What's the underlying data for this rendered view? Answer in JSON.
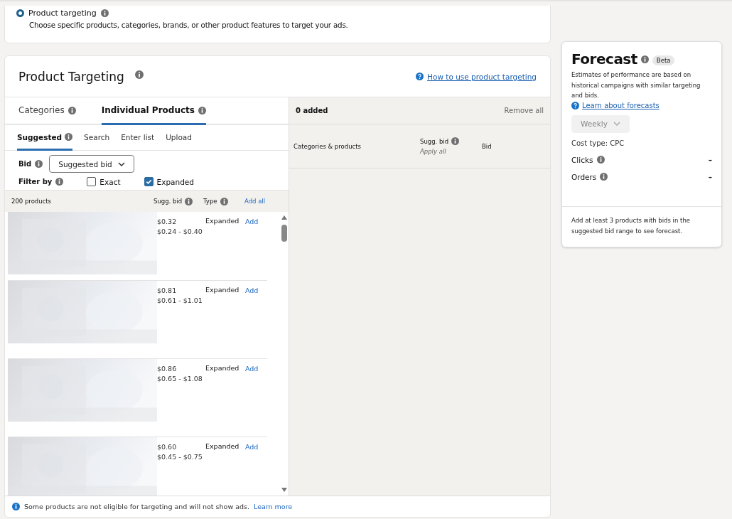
{
  "targeting_option": {
    "label": "Product targeting",
    "selected": true,
    "description": "Choose specific products, categories, brands, or other product features to target your ads."
  },
  "product_targeting": {
    "title": "Product Targeting",
    "help_link": "How to use product targeting",
    "tabs": [
      {
        "label": "Categories",
        "selected": false
      },
      {
        "label": "Individual Products",
        "selected": true
      }
    ],
    "subtabs": [
      {
        "label": "Suggested",
        "selected": true,
        "info": true
      },
      {
        "label": "Search",
        "selected": false,
        "info": false
      },
      {
        "label": "Enter list",
        "selected": false,
        "info": false
      },
      {
        "label": "Upload",
        "selected": false,
        "info": false
      }
    ],
    "bid": {
      "label": "Bid",
      "dropdown": "Suggested bid"
    },
    "filter": {
      "label": "Filter by",
      "options": [
        {
          "label": "Exact",
          "checked": false
        },
        {
          "label": "Expanded",
          "checked": true
        }
      ]
    },
    "list_header": {
      "count": "200 products",
      "sugg_bid": "Sugg. bid",
      "type": "Type",
      "add_all": "Add all"
    },
    "products": [
      {
        "kind": "picture",
        "bid": "$0.32",
        "range": "$0.24 - $0.40",
        "type": "Expanded",
        "action": "Add"
      },
      {
        "kind": "picture",
        "bid": "$0.81",
        "range": "$0.61 - $1.01",
        "type": "Expanded",
        "action": "Add"
      },
      {
        "kind": "picture",
        "bid": "$0.86",
        "range": "$0.65 - $1.08",
        "type": "Expanded",
        "action": "Add"
      },
      {
        "kind": "picture",
        "bid": "$0.60",
        "range": "$0.45 - $0.75",
        "type": "Expanded",
        "action": "Add"
      }
    ],
    "notice": {
      "text": "Some products are not eligible for targeting and will not show ads.",
      "link": "Learn more"
    },
    "added": {
      "count": "0 added",
      "remove_all": "Remove all",
      "col_products": "Categories & products",
      "col_sugg_bid": "Sugg. bid",
      "apply_all": "Apply all",
      "col_bid": "Bid"
    }
  },
  "forecast": {
    "title": "Forecast",
    "badge": "Beta",
    "description": "Estimates of performance are based on historical campaigns with similar targeting and bids.",
    "link": "Learn about forecasts",
    "period": "Weekly",
    "cost_type": "Cost type: CPC",
    "metrics": [
      {
        "label": "Clicks",
        "value": "–"
      },
      {
        "label": "Orders",
        "value": "–"
      }
    ],
    "note": "Add at least 3 products with bids in the suggested bid range to see forecast."
  }
}
